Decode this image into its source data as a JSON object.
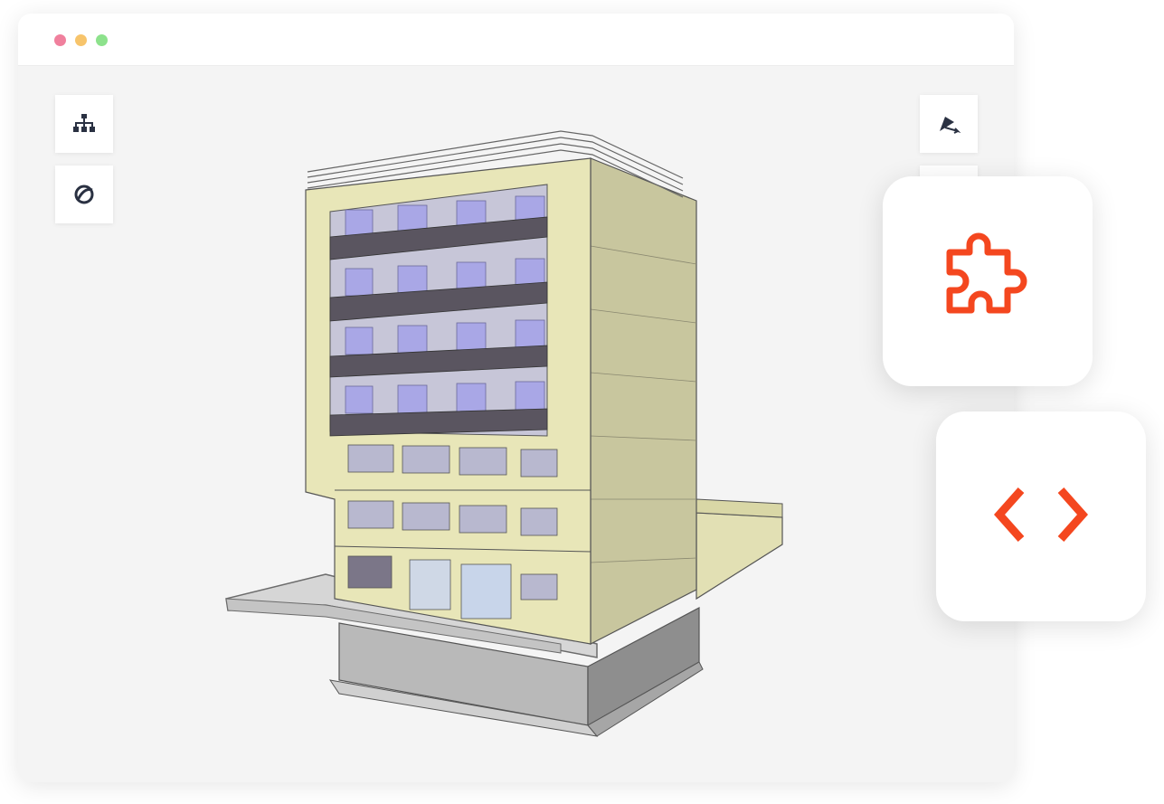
{
  "window": {
    "traffic_lights": [
      {
        "name": "close",
        "color": "#f0809d"
      },
      {
        "name": "minimize",
        "color": "#f7c46b"
      },
      {
        "name": "maximize",
        "color": "#8de28c"
      }
    ],
    "background": "#f4f4f4"
  },
  "toolbar_left": [
    {
      "icon": "hierarchy-icon",
      "tooltip": ""
    },
    {
      "icon": "orbit-icon",
      "tooltip": ""
    }
  ],
  "toolbar_right": [
    {
      "icon": "section-plane-icon"
    },
    {
      "icon": "measure-icon"
    }
  ],
  "feature_cards": [
    {
      "icon": "puzzle-piece-icon",
      "color": "#f4471f"
    },
    {
      "icon": "code-brackets-icon",
      "color": "#f4471f"
    }
  ],
  "colors": {
    "accent": "#f4471f",
    "icon_dark": "#2a3142",
    "facade": "#e8e6b8",
    "glass": "#a9a7e6",
    "base": "#9a9a9a"
  }
}
